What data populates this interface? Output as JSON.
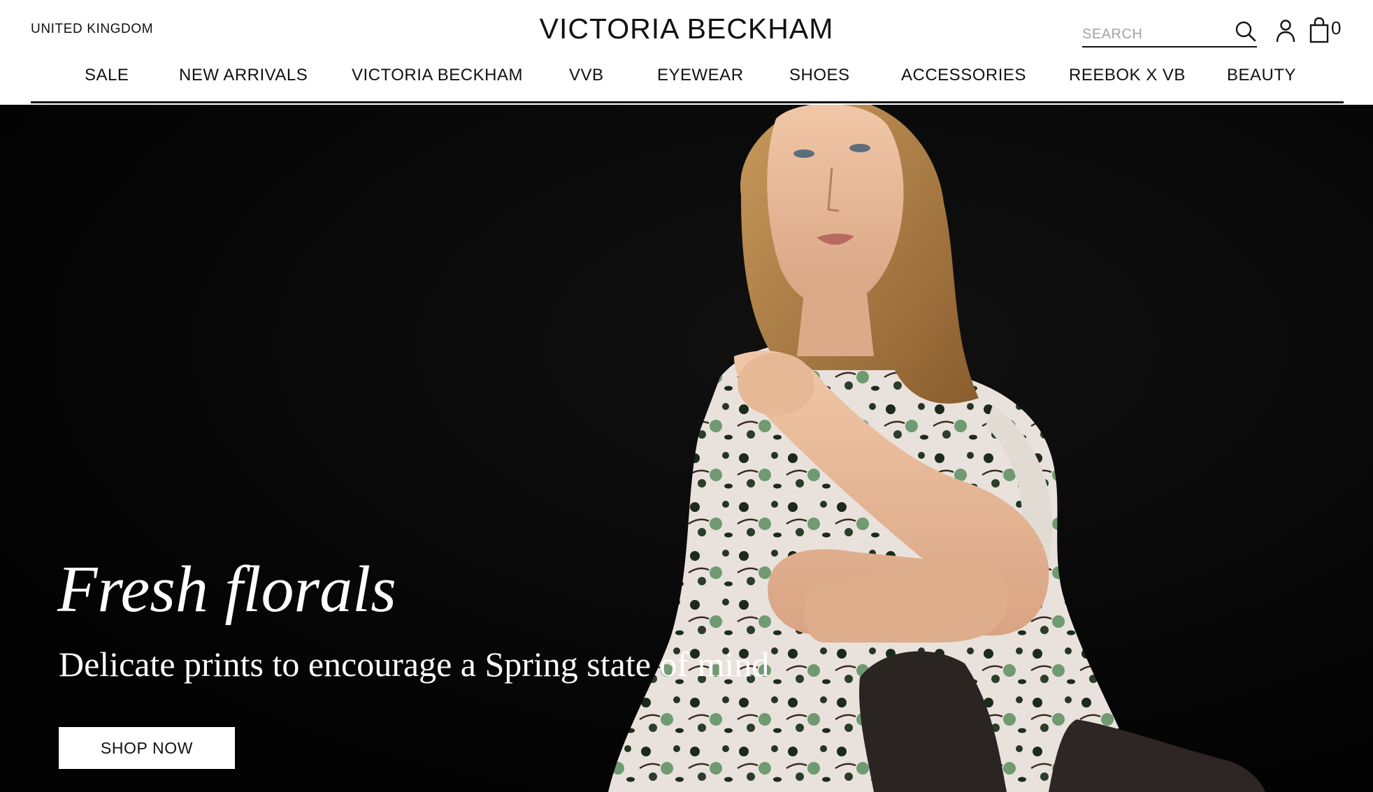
{
  "header": {
    "region": "UNITED KINGDOM",
    "logo": "VICTORIA BECKHAM",
    "search": {
      "placeholder": "SEARCH",
      "value": ""
    },
    "bag_count": "0",
    "icons": [
      "search-icon",
      "account-icon",
      "shopping-bag-icon"
    ]
  },
  "nav": {
    "items": [
      {
        "label": "SALE"
      },
      {
        "label": "NEW ARRIVALS"
      },
      {
        "label": "VICTORIA BECKHAM"
      },
      {
        "label": "VVB"
      },
      {
        "label": "EYEWEAR"
      },
      {
        "label": "SHOES"
      },
      {
        "label": "ACCESSORIES"
      },
      {
        "label": "REEBOK X VB"
      },
      {
        "label": "BEAUTY"
      }
    ]
  },
  "hero": {
    "title": "Fresh florals",
    "subtitle": "Delicate prints to encourage a Spring state of mind",
    "cta": "SHOP NOW"
  },
  "colors": {
    "text": "#111111",
    "hero_background": "#050505",
    "accent_white": "#ffffff",
    "placeholder": "#a3a3a3"
  }
}
